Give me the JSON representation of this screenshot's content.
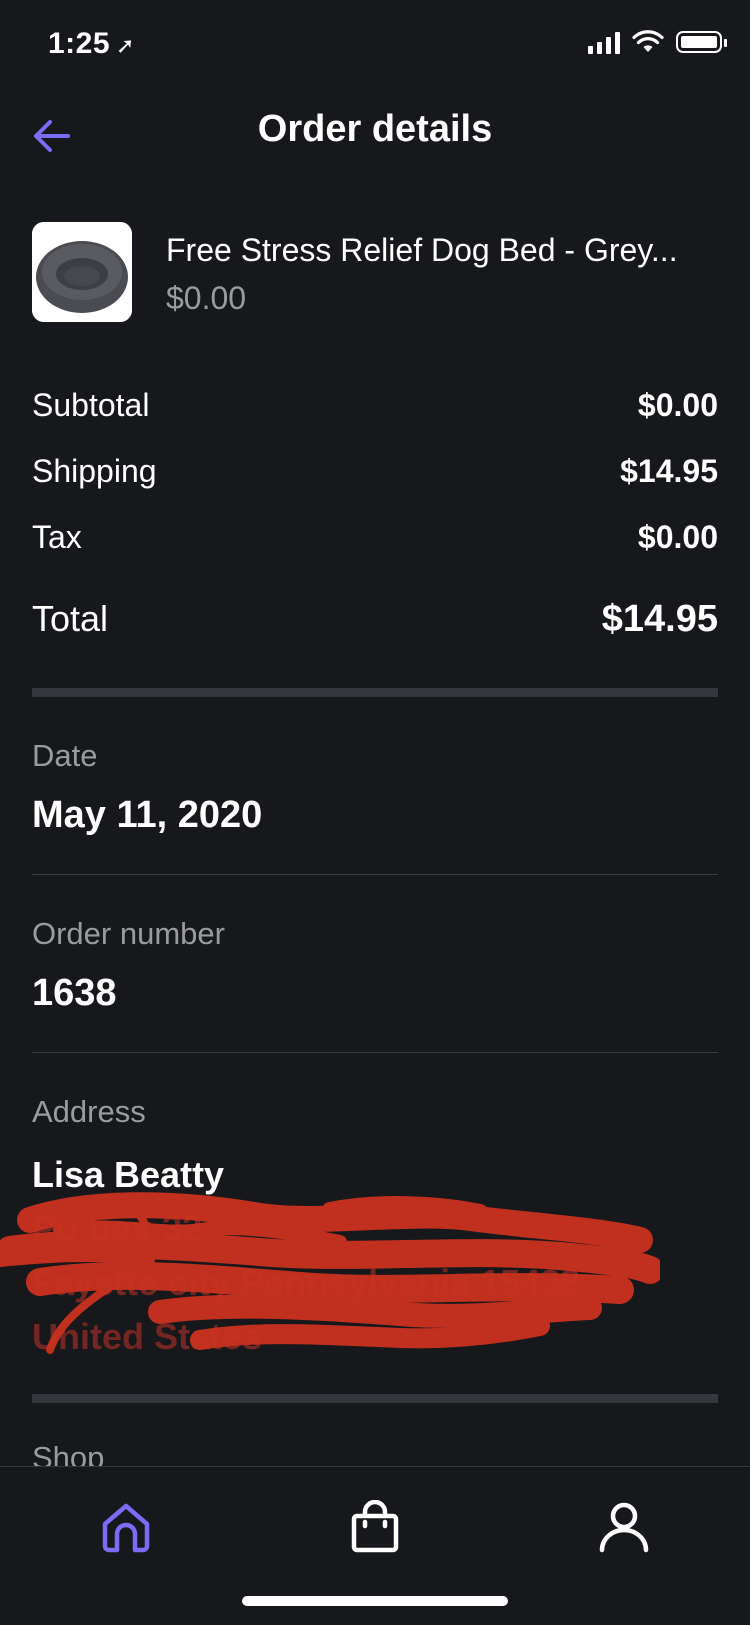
{
  "status_bar": {
    "time": "1:25",
    "location_arrow": "➤"
  },
  "nav": {
    "title": "Order details",
    "back_icon": "arrow-left-icon",
    "accent_color": "#7b6cf6"
  },
  "product": {
    "name": "Free Stress Relief Dog Bed - Grey...",
    "price": "$0.00"
  },
  "summary": {
    "subtotal_label": "Subtotal",
    "subtotal_value": "$0.00",
    "shipping_label": "Shipping",
    "shipping_value": "$14.95",
    "tax_label": "Tax",
    "tax_value": "$0.00",
    "total_label": "Total",
    "total_value": "$14.95"
  },
  "info": {
    "date_label": "Date",
    "date_value": "May 11, 2020",
    "order_number_label": "Order number",
    "order_number_value": "1638",
    "address_label": "Address",
    "address_name": "Lisa Beatty",
    "address_line1": "Po box 32",
    "address_line2": "Fayette city Pennsylvania 15438",
    "address_country": "United States",
    "shop_label": "Shop"
  },
  "tab_bar": {
    "items": [
      {
        "icon": "home-icon",
        "active": true
      },
      {
        "icon": "shopping-bag-icon",
        "active": false
      },
      {
        "icon": "user-icon",
        "active": false
      }
    ]
  }
}
